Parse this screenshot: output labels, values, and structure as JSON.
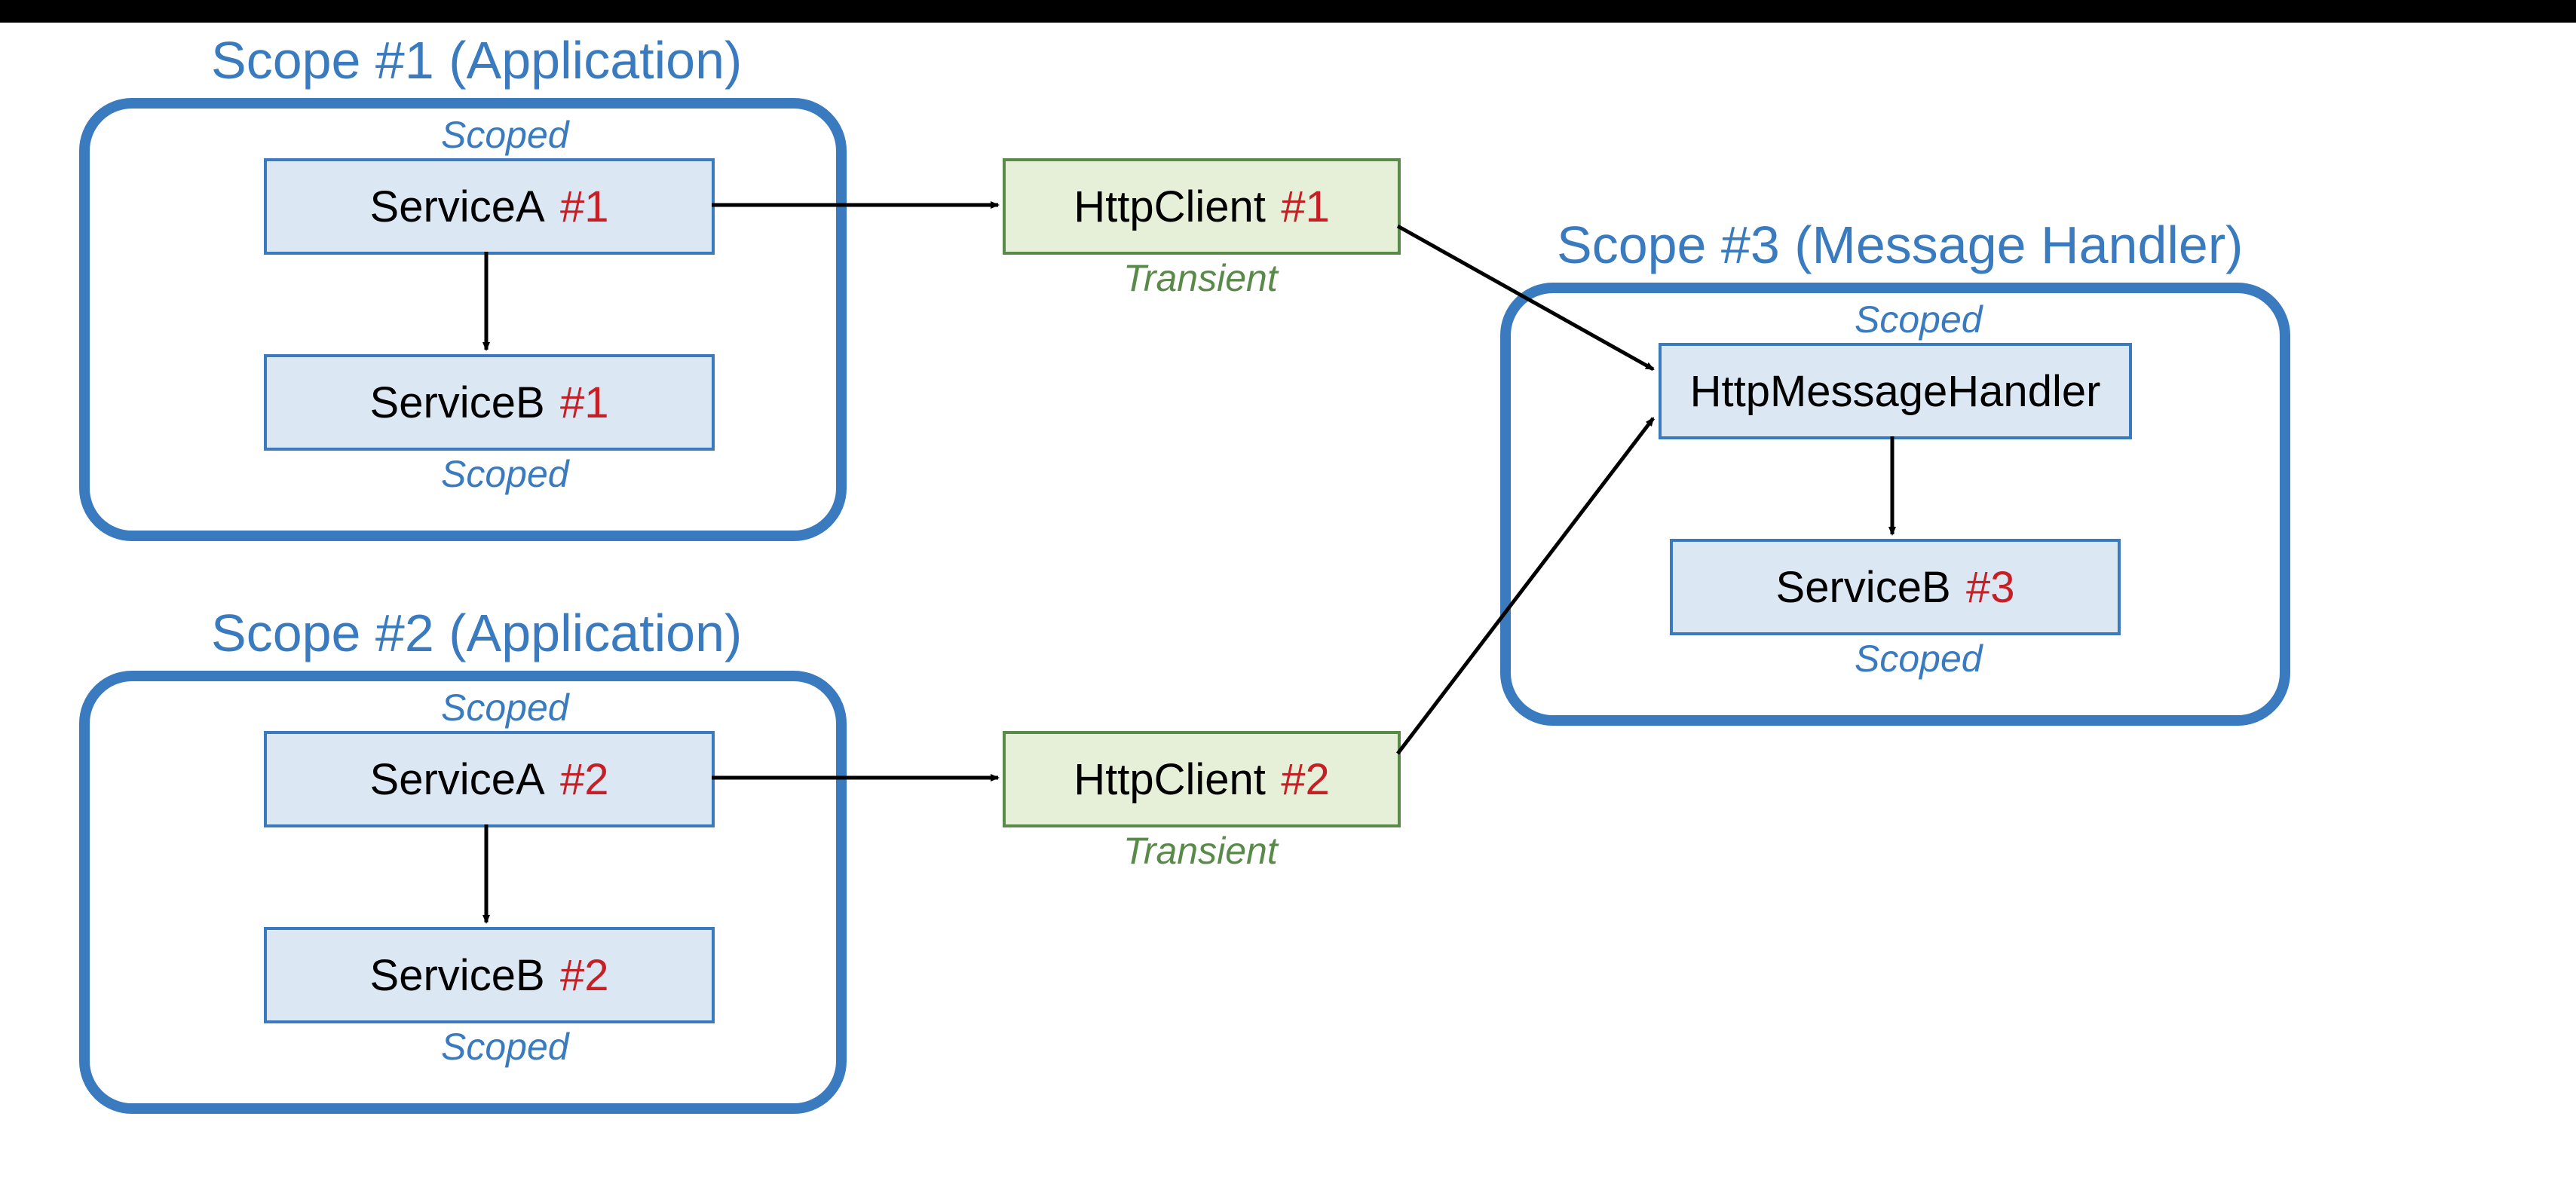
{
  "scopes": {
    "scope1": {
      "title": "Scope #1 (Application)"
    },
    "scope2": {
      "title": "Scope #2 (Application)"
    },
    "scope3": {
      "title": "Scope #3 (Message Handler)"
    }
  },
  "lifetimes": {
    "scoped": "Scoped",
    "transient": "Transient"
  },
  "boxes": {
    "serviceA1": {
      "name": "ServiceA",
      "num": "#1"
    },
    "serviceB1": {
      "name": "ServiceB",
      "num": "#1"
    },
    "serviceA2": {
      "name": "ServiceA",
      "num": "#2"
    },
    "serviceB2": {
      "name": "ServiceB",
      "num": "#2"
    },
    "httpClient1": {
      "name": "HttpClient",
      "num": "#1"
    },
    "httpClient2": {
      "name": "HttpClient",
      "num": "#2"
    },
    "httpMessageHandler": {
      "name": "HttpMessageHandler",
      "num": ""
    },
    "serviceB3": {
      "name": "ServiceB",
      "num": "#3"
    }
  },
  "colors": {
    "scopeBorder": "#3a7bbf",
    "scopeText": "#3a7bbf",
    "serviceFill": "#dbe8f4",
    "httpBorder": "#5a8a4a",
    "httpFill": "#e6f0d9",
    "instanceNum": "#c52026",
    "arrow": "#000000"
  }
}
